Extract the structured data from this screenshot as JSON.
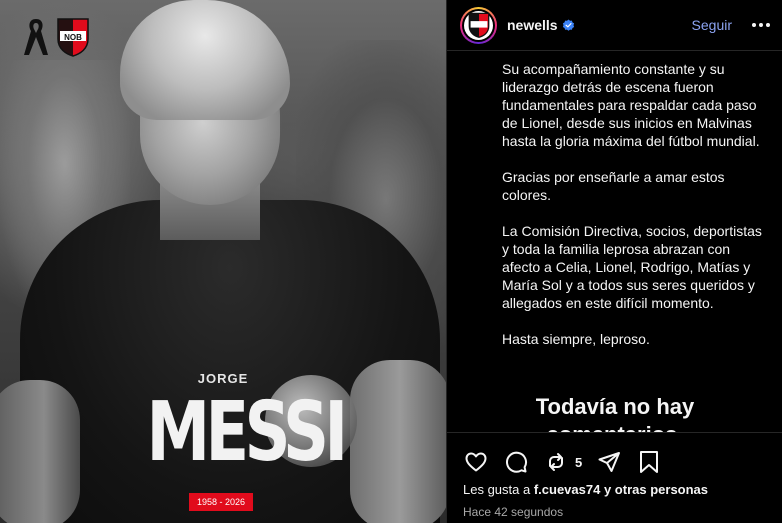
{
  "post_image": {
    "first_name": "JORGE",
    "last_name": "MESSI",
    "years": "1958 - 2026",
    "badge_text": "NOB",
    "colors": {
      "club_red": "#e10b1c",
      "club_black": "#000000"
    }
  },
  "header": {
    "username": "newells",
    "verified": true,
    "follow_label": "Seguir",
    "avatar_text": "NOB"
  },
  "caption": {
    "paragraphs": [
      "Su acompañamiento constante y su liderazgo detrás de escena fueron fundamentales para respaldar cada paso de Lionel, desde sus inicios en Malvinas hasta la gloria máxima del fútbol mundial.",
      "Gracias por enseñarle a amar estos colores.",
      "La Comisión Directiva, socios, deportistas y toda la familia leprosa abrazan con afecto a Celia, Lionel, Rodrigo, Matías y María Sol y a todos sus seres queridos y allegados en este difícil momento.",
      "Hasta siempre, leproso."
    ]
  },
  "comments_empty": {
    "title_line1": "Todavía no hay",
    "title_line2": "comentarios."
  },
  "actions": {
    "repost_count": "5",
    "likes_prefix": "Les gusta a",
    "likes_user": "f.cuevas74",
    "likes_suffix": "y otras personas",
    "timestamp": "Hace 42 segundos"
  },
  "icons": [
    "mourning-ribbon-icon",
    "club-badge-icon",
    "verified-badge-icon",
    "more-options-icon",
    "heart-icon",
    "comment-icon",
    "repost-icon",
    "share-icon",
    "bookmark-icon"
  ],
  "theme": {
    "background": "#000000",
    "link_blue": "#8ca4f2",
    "muted": "#a8a8a8",
    "divider": "#262626"
  }
}
